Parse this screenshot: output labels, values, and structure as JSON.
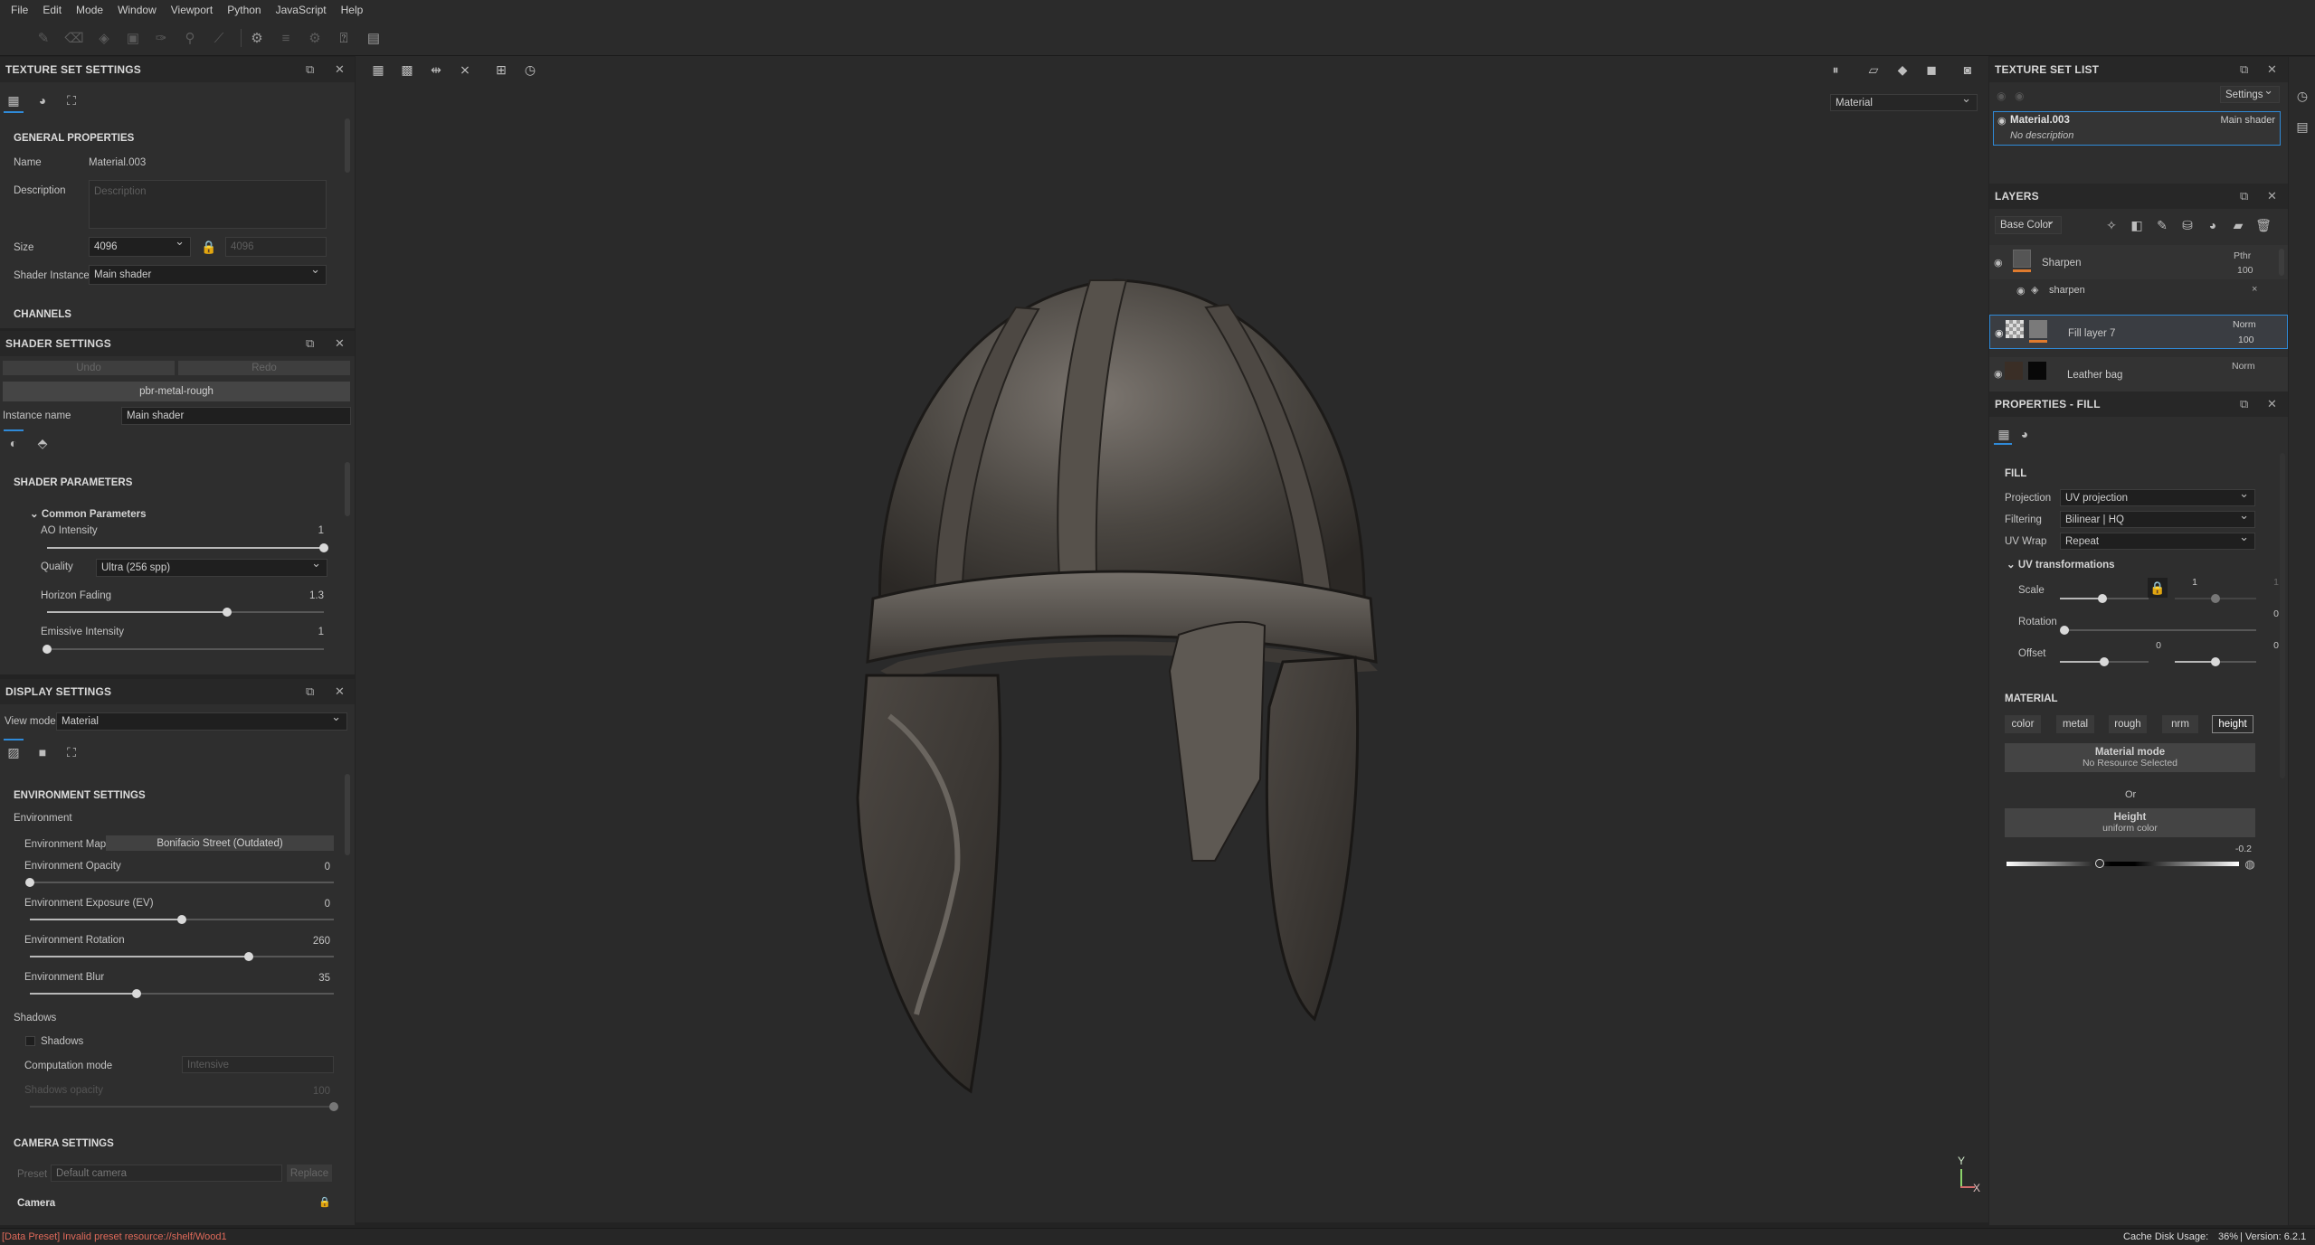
{
  "menu": [
    "File",
    "Edit",
    "Mode",
    "Window",
    "Viewport",
    "Python",
    "JavaScript",
    "Help"
  ],
  "texture_set_settings": {
    "title": "TEXTURE SET SETTINGS",
    "general_properties": "GENERAL PROPERTIES",
    "name_label": "Name",
    "name_value": "Material.003",
    "description_label": "Description",
    "description_placeholder": "Description",
    "size_label": "Size",
    "size_value": "4096",
    "size_linked": "4096",
    "shader_instance_label": "Shader Instance",
    "shader_instance_value": "Main shader",
    "channels": "CHANNELS"
  },
  "shader_settings": {
    "title": "SHADER SETTINGS",
    "undo": "Undo",
    "redo": "Redo",
    "shader_name": "pbr-metal-rough",
    "instance_name_label": "Instance name",
    "instance_name_value": "Main shader",
    "shader_parameters": "SHADER PARAMETERS",
    "common_parameters": "Common Parameters",
    "ao_intensity_label": "AO Intensity",
    "ao_intensity_value": "1",
    "ao_intensity_level": 1.0,
    "quality_label": "Quality",
    "quality_value": "Ultra (256 spp)",
    "horizon_fading_label": "Horizon Fading",
    "horizon_fading_value": "1.3",
    "horizon_fading_level": 0.65,
    "emissive_label": "Emissive Intensity",
    "emissive_value": "1",
    "emissive_level": 0.0
  },
  "display_settings": {
    "title": "DISPLAY SETTINGS",
    "view_mode_label": "View mode",
    "view_mode_value": "Material",
    "environment_settings": "ENVIRONMENT SETTINGS",
    "environment": "Environment",
    "env_map_label": "Environment Map",
    "env_map_value": "Bonifacio Street (Outdated)",
    "env_opacity_label": "Environment Opacity",
    "env_opacity_value": "0",
    "env_opacity_level": 0.0,
    "env_exposure_label": "Environment Exposure (EV)",
    "env_exposure_value": "0",
    "env_exposure_level": 0.5,
    "env_rotation_label": "Environment Rotation",
    "env_rotation_value": "260",
    "env_rotation_level": 0.72,
    "env_blur_label": "Environment Blur",
    "env_blur_value": "35",
    "env_blur_level": 0.35,
    "shadows": "Shadows",
    "shadows_checkbox": "Shadows",
    "computation_label": "Computation mode",
    "computation_value": "Intensive",
    "shadows_opacity_label": "Shadows opacity",
    "shadows_opacity_value": "100",
    "camera_settings": "CAMERA SETTINGS",
    "preset_label": "Preset",
    "preset_value": "Default camera",
    "replace": "Replace",
    "camera": "Camera"
  },
  "viewport": {
    "mode_value": "Material"
  },
  "texture_set_list": {
    "title": "TEXTURE SET LIST",
    "settings": "Settings",
    "item_name": "Material.003",
    "item_shader": "Main shader",
    "item_description": "No description"
  },
  "layers": {
    "title": "LAYERS",
    "channel": "Base Color",
    "rows": [
      {
        "name": "Sharpen",
        "blend": "Pthr",
        "opacity": "100"
      },
      {
        "name": "sharpen",
        "blend": "",
        "opacity": ""
      },
      {
        "name": "Fill layer 7",
        "blend": "Norm",
        "opacity": "100"
      },
      {
        "name": "Leather bag",
        "blend": "Norm",
        "opacity": ""
      }
    ]
  },
  "properties_fill": {
    "title": "PROPERTIES - FILL",
    "fill": "FILL",
    "projection_label": "Projection",
    "projection_value": "UV projection",
    "filtering_label": "Filtering",
    "filtering_value": "Bilinear | HQ",
    "uvwrap_label": "UV Wrap",
    "uvwrap_value": "Repeat",
    "uv_transformations": "UV transformations",
    "scale_label": "Scale",
    "scale_value": "1",
    "scale_value2": "1",
    "rotation_label": "Rotation",
    "rotation_value": "0",
    "offset_label": "Offset",
    "offset_value": "0",
    "offset_value2": "0",
    "material": "MATERIAL",
    "channels": [
      "color",
      "metal",
      "rough",
      "nrm",
      "height"
    ],
    "material_mode": "Material mode",
    "no_resource": "No Resource Selected",
    "or": "Or",
    "height": "Height",
    "uniform_color": "uniform color",
    "height_value": "-0.2",
    "height_level": 0.4
  },
  "status": {
    "error": "[Data Preset] Invalid preset resource://shelf/Wood1",
    "cache": "Cache Disk Usage:",
    "cache_value": "36%",
    "version": "| Version: 6.2.1"
  }
}
